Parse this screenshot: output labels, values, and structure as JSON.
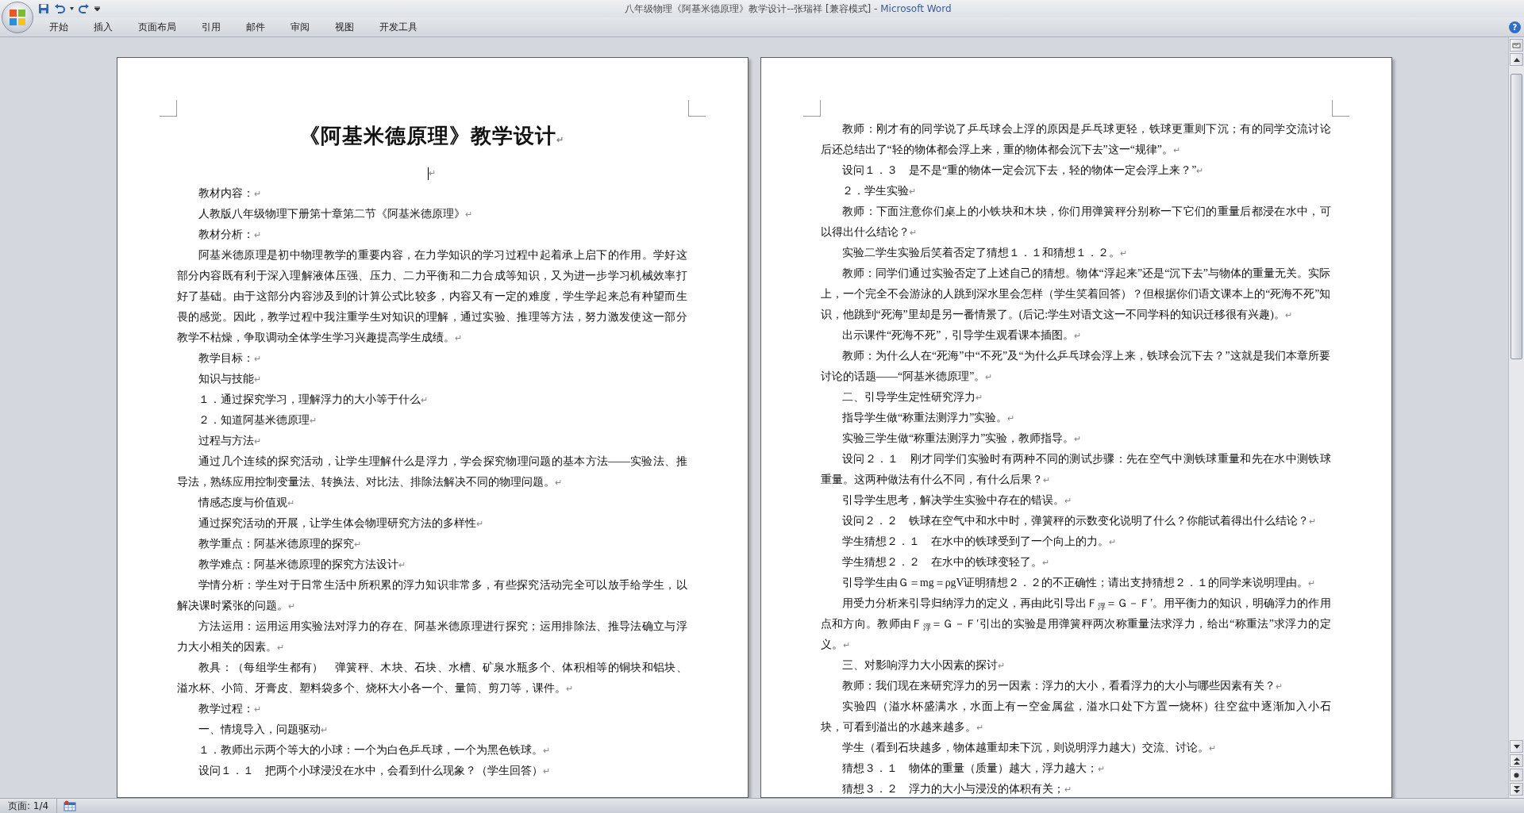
{
  "window": {
    "document_title": "八年级物理《阿基米德原理》教学设计--张瑞祥 [兼容模式]",
    "separator": "-",
    "app_name": "Microsoft Word"
  },
  "ribbon": {
    "tabs": [
      {
        "label": "开始"
      },
      {
        "label": "插入"
      },
      {
        "label": "页面布局"
      },
      {
        "label": "引用"
      },
      {
        "label": "邮件"
      },
      {
        "label": "审阅"
      },
      {
        "label": "视图"
      },
      {
        "label": "开发工具"
      }
    ],
    "help": "?"
  },
  "pages": [
    {
      "paragraphs": [
        {
          "kind": "title",
          "text": "《阿基米德原理》教学设计",
          "mark": "↵"
        },
        {
          "kind": "cursor",
          "mark": "↵"
        },
        {
          "kind": "body",
          "text": "教材内容：",
          "mark": "↵"
        },
        {
          "kind": "body",
          "text": "人教版八年级物理下册第十章第二节《阿基米德原理》",
          "mark": "↵"
        },
        {
          "kind": "body",
          "text": "教材分析：",
          "mark": "↵"
        },
        {
          "kind": "body",
          "text": "阿基米德原理是初中物理教学的重要内容，在力学知识的学习过程中起着承上启下的作用。学好这部分内容既有利于深入理解液体压强、压力、二力平衡和二力合成等知识，又为进一步学习机械效率打好了基础。由于这部分内容涉及到的计算公式比较多，内容又有一定的难度，学生学起来总有种望而生畏的感觉。因此，教学过程中我注重学生对知识的理解，通过实验、推理等方法，努力激发使这一部分教学不枯燥，争取调动全体学生学习兴趣提高学生成绩。",
          "mark": "↵"
        },
        {
          "kind": "body",
          "text": "教学目标：",
          "mark": "↵"
        },
        {
          "kind": "body",
          "text": "知识与技能",
          "mark": "↵"
        },
        {
          "kind": "body",
          "text": "１．通过探究学习，理解浮力的大小等于什么",
          "mark": "↵"
        },
        {
          "kind": "body",
          "text": "２．知道阿基米德原理",
          "mark": "↵"
        },
        {
          "kind": "body",
          "text": "过程与方法",
          "mark": "↵"
        },
        {
          "kind": "body",
          "text": "通过几个连续的探究活动，让学生理解什么是浮力，学会探究物理问题的基本方法——实验法、推导法，熟练应用控制变量法、转换法、对比法、排除法解决不同的物理问题。",
          "mark": "↵"
        },
        {
          "kind": "body",
          "text": "情感态度与价值观",
          "mark": "↵"
        },
        {
          "kind": "body",
          "text": "通过探究活动的开展，让学生体会物理研究方法的多样性",
          "mark": "↵"
        },
        {
          "kind": "body",
          "text": "教学重点：阿基米德原理的探究",
          "mark": "↵"
        },
        {
          "kind": "body",
          "text": "教学难点：阿基米德原理的探究方法设计",
          "mark": "↵"
        },
        {
          "kind": "body",
          "text": "学情分析：学生对于日常生活中所积累的浮力知识非常多，有些探究活动完全可以放手给学生，以解决课时紧张的问题。",
          "mark": "↵"
        },
        {
          "kind": "body",
          "text": "方法运用：运用运用实验法对浮力的存在、阿基米德原理进行探究；运用排除法、推导法确立与浮力大小相关的因素。",
          "mark": "↵"
        },
        {
          "kind": "body",
          "text": "教具：（每组学生都有）　弹簧秤、木块、石块、水槽、矿泉水瓶多个、体积相等的铜块和铝块、溢水杯、小筒、牙膏皮、塑料袋多个、烧杯大小各一个、量筒、剪刀等，课件。",
          "mark": "↵"
        },
        {
          "kind": "body",
          "text": "教学过程：",
          "mark": "↵"
        },
        {
          "kind": "body",
          "text": "一、情境导入，问题驱动",
          "mark": "↵"
        },
        {
          "kind": "body",
          "text": "１．教师出示两个等大的小球：一个为白色乒乓球，一个为黑色铁球。",
          "mark": "↵"
        },
        {
          "kind": "body",
          "text": "设问１．１　把两个小球浸没在水中，会看到什么现象？（学生回答）",
          "mark": "↵"
        }
      ]
    },
    {
      "paragraphs": [
        {
          "kind": "body",
          "text": "教师：刚才有的同学说了乒乓球会上浮的原因是乒乓球更轻，铁球更重则下沉；有的同学交流讨论后还总结出了“轻的物体都会浮上来，重的物体都会沉下去”这一“规律”。",
          "mark": "↵"
        },
        {
          "kind": "body",
          "text": "设问１．３　是不是“重的物体一定会沉下去，轻的物体一定会浮上来？”",
          "mark": "↵"
        },
        {
          "kind": "body",
          "text": "２．学生实验",
          "mark": "↵"
        },
        {
          "kind": "body",
          "text": "教师：下面注意你们桌上的小铁块和木块，你们用弹簧秤分别称一下它们的重量后都浸在水中，可以得出什么结论？",
          "mark": "↵"
        },
        {
          "kind": "body",
          "text": "实验二学生实验后笑着否定了猜想１．１和猜想１．２。",
          "mark": "↵"
        },
        {
          "kind": "body",
          "text": "教师：同学们通过实验否定了上述自己的猜想。物体“浮起来”还是“沉下去”与物体的重量无关。实际上，一个完全不会游泳的人跳到深水里会怎样（学生笑着回答）？但根据你们语文课本上的“死海不死”知识，他跳到“死海”里却是另一番情景了。(后记:学生对语文这一不同学科的知识迁移很有兴趣)。",
          "mark": "↵"
        },
        {
          "kind": "body",
          "text": "出示课件“死海不死”，引导学生观看课本插图。",
          "mark": "↵"
        },
        {
          "kind": "body",
          "text": "教师：为什么人在“死海”中“不死”及“为什么乒乓球会浮上来，铁球会沉下去？”这就是我们本章所要讨论的话题——“阿基米德原理”。",
          "mark": "↵"
        },
        {
          "kind": "body",
          "text": "二、引导学生定性研究浮力",
          "mark": "↵"
        },
        {
          "kind": "body",
          "text": "指导学生做“称重法测浮力”实验。",
          "mark": "↵"
        },
        {
          "kind": "body",
          "text": "实验三学生做“称重法测浮力”实验，教师指导。",
          "mark": "↵"
        },
        {
          "kind": "body",
          "text": "设问２．１　刚才同学们实验时有两种不同的测试步骤：先在空气中测铁球重量和先在水中测铁球重量。这两种做法有什么不同，有什么后果？",
          "mark": "↵"
        },
        {
          "kind": "body",
          "text": "引导学生思考，解决学生实验中存在的错误。",
          "mark": "↵"
        },
        {
          "kind": "body",
          "text": "设问２．２　铁球在空气中和水中时，弹簧秤的示数变化说明了什么？你能试着得出什么结论？",
          "mark": "↵"
        },
        {
          "kind": "body",
          "text": "学生猜想２．１　在水中的铁球受到了一个向上的力。",
          "mark": "↵"
        },
        {
          "kind": "body",
          "text": "学生猜想２．２　在水中的铁球变轻了。",
          "mark": "↵"
        },
        {
          "kind": "body",
          "text": "引导学生由Ｇ＝mg＝ρgV证明猜想２．２的不正确性；请出支持猜想２．１的同学来说明理由。",
          "mark": "↵"
        },
        {
          "kind": "body",
          "text": "用受力分析来引导归纳浮力的定义，再由此引导出Ｆ$_{浮}$＝Ｇ－Ｆ′。用平衡力的知识，明确浮力的作用点和方向。教师由Ｆ$_{浮}$＝Ｇ－Ｆ′引出的实验是用弹簧秤两次称重量法求浮力，给出“称重法”求浮力的定义。",
          "mark": "↵"
        },
        {
          "kind": "body",
          "text": "三、对影响浮力大小因素的探讨",
          "mark": "↵"
        },
        {
          "kind": "body",
          "text": "教师：我们现在来研究浮力的另一因素：浮力的大小，看看浮力的大小与哪些因素有关？",
          "mark": "↵"
        },
        {
          "kind": "body",
          "text": "实验四（溢水杯盛满水，水面上有一空金属盆，溢水口处下方置一烧杯）往空盆中逐渐加入小石块，可看到溢出的水越来越多。",
          "mark": "↵"
        },
        {
          "kind": "body",
          "text": "学生（看到石块越多，物体越重却未下沉，则说明浮力越大）交流、讨论。",
          "mark": "↵"
        },
        {
          "kind": "body",
          "text": "猜想３．１　物体的重量（质量）越大，浮力越大；",
          "mark": "↵"
        },
        {
          "kind": "body",
          "text": "猜想３．２　浮力的大小与浸没的体积有关；",
          "mark": "↵"
        }
      ]
    }
  ],
  "status_bar": {
    "page": "页面: 1/4"
  }
}
